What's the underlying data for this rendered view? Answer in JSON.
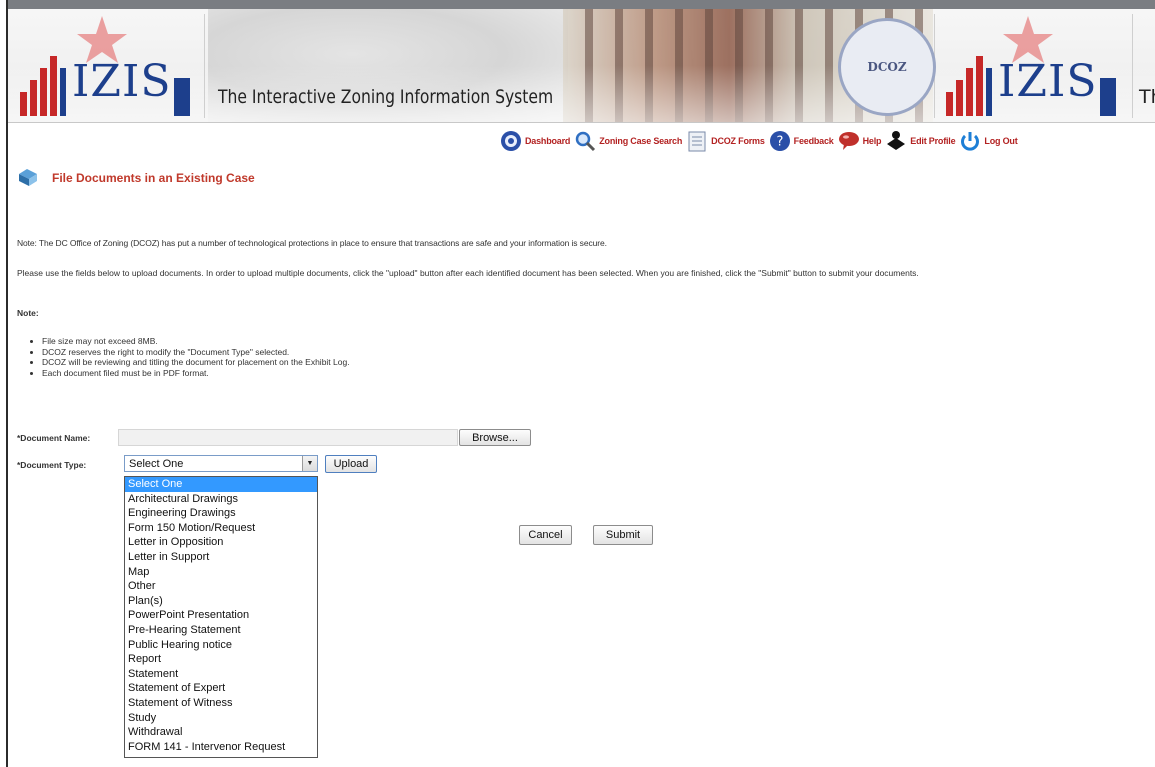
{
  "banner": {
    "logo_text": "IZIS",
    "tagline": "The Interactive Zoning Information System",
    "tagline_cut": "Th",
    "seal_text": "DCOZ"
  },
  "nav": [
    {
      "label": "Dashboard",
      "icon": "dashboard-icon",
      "color": "#2a4fa8"
    },
    {
      "label": "Zoning Case Search",
      "icon": "magnifier-icon",
      "color": "#2f6fc2"
    },
    {
      "label": "DCOZ Forms",
      "icon": "forms-icon",
      "color": "#7a8aa8"
    },
    {
      "label": "Feedback",
      "icon": "feedback-icon",
      "color": "#2a4fa8"
    },
    {
      "label": "Help",
      "icon": "help-icon",
      "color": "#c0302b"
    },
    {
      "label": "Edit Profile",
      "icon": "edit-profile-icon",
      "color": "#111111"
    },
    {
      "label": "Log Out",
      "icon": "power-icon",
      "color": "#1e7fd6"
    }
  ],
  "page": {
    "title": "File Documents in an Existing Case",
    "security_note": "Note: The DC Office of Zoning (DCOZ) has put a number of technological protections in place to ensure that transactions are safe and your information is secure.",
    "instructions": "Please use the fields below to upload documents. In order to upload multiple documents, click the \"upload\" button after each identified document has been selected. When you are finished, click the \"Submit\" button to submit your documents.",
    "note_label": "Note:",
    "bullets": [
      "File size may not exceed 8MB.",
      "DCOZ reserves the right to modify the \"Document Type\" selected.",
      "DCOZ will be reviewing and titling the document for placement on the Exhibit Log.",
      "Each document filed must be in PDF format."
    ]
  },
  "form": {
    "document_name_label": "*Document Name:",
    "document_name_value": "",
    "browse_label": "Browse...",
    "document_type_label": "*Document Type:",
    "document_type_selected": "Select One",
    "upload_label": "Upload",
    "cancel_label": "Cancel",
    "submit_label": "Submit",
    "document_type_options": [
      "Select One",
      "Architectural Drawings",
      "Engineering Drawings",
      "Form 150 Motion/Request",
      "Letter in Opposition",
      "Letter in Support",
      "Map",
      "Other",
      "Plan(s)",
      "PowerPoint Presentation",
      "Pre-Hearing Statement",
      "Public Hearing notice",
      "Report",
      "Statement",
      "Statement of Expert",
      "Statement of Witness",
      "Study",
      "Withdrawal",
      "FORM 141 - Intervenor Request"
    ],
    "highlighted_option_index": 0
  },
  "colors": {
    "accent_red": "#c0392b",
    "logo_blue": "#1d3f8c",
    "selection_blue": "#3399ff"
  }
}
